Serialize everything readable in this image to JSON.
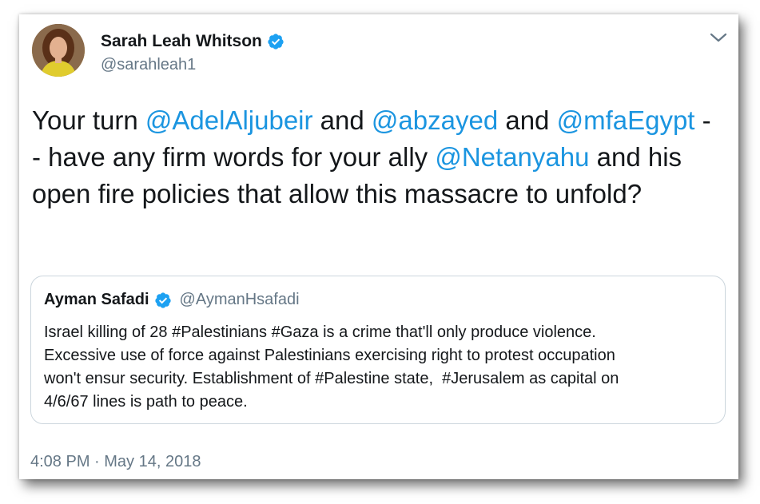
{
  "tweet": {
    "author": {
      "display_name": "Sarah Leah Whitson",
      "handle": "@sarahleah1",
      "verified_icon": "verified-badge-icon"
    },
    "menu_icon": "chevron-down-icon",
    "text_parts": [
      {
        "text": "Your turn ",
        "type": "text"
      },
      {
        "text": "@AdelAljubeir",
        "type": "mention"
      },
      {
        "text": " and ",
        "type": "text"
      },
      {
        "text": "@abzayed",
        "type": "mention"
      },
      {
        "text": " and ",
        "type": "text"
      },
      {
        "text": "@mfaEgypt",
        "type": "mention"
      },
      {
        "text": " -- have any firm words for your ally ",
        "type": "text"
      },
      {
        "text": "@Netanyahu",
        "type": "mention"
      },
      {
        "text": " and his open fire policies that allow this massacre to unfold?",
        "type": "text"
      }
    ],
    "quoted": {
      "display_name": "Ayman Safadi",
      "handle": "@AymanHsafadi",
      "text": "Israel killing of 28 #Palestinians #Gaza is a crime that'll only produce violence.\nExcessive use of force against Palestinians exercising right to protest occupation\nwon't ensur security. Establishment of #Palestine state,  #Jerusalem as capital on\n4/6/67 lines is path to peace."
    },
    "timestamp": "4:08 PM · May 14, 2018"
  },
  "colors": {
    "mention": "#1b95e0",
    "verified": "#1da1f2",
    "secondary_text": "#657786",
    "primary_text": "#14171a",
    "quote_border": "#ccd6dd"
  }
}
